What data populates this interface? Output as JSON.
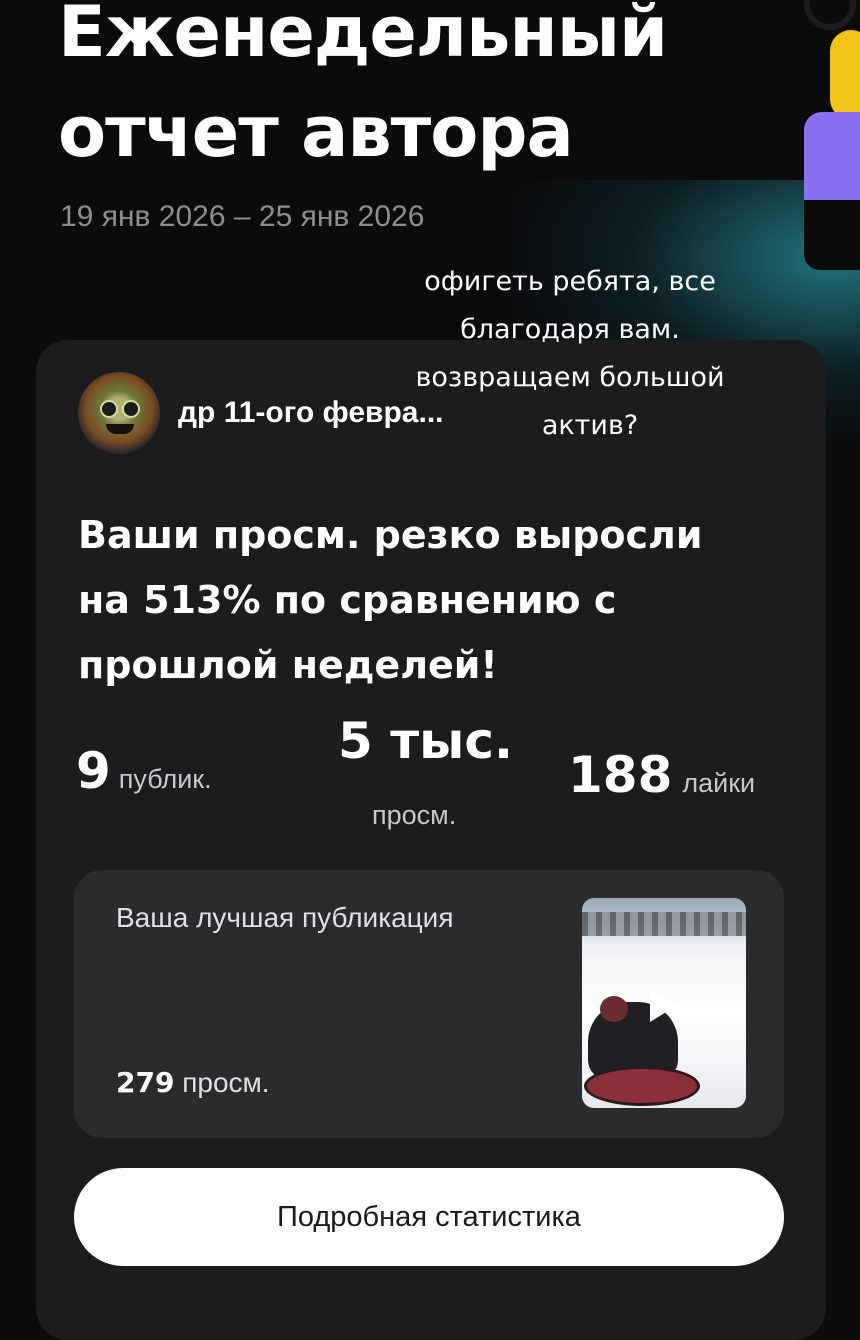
{
  "header": {
    "title_line1": "Еженедельный",
    "title_line2": "отчет автора",
    "date_range": "19 янв 2026 – 25 янв 2026"
  },
  "overlay_caption": {
    "line1": "офигеть ребята, все",
    "line2": "благодаря вам.",
    "line3": "возвращаем большой",
    "line4": "актив?"
  },
  "channel": {
    "name": "др 11-ого февра..."
  },
  "headline": {
    "line1": "Ваши просм. резко выросли",
    "line2": "на 513% по сравнению с",
    "line3": "прошлой неделей!"
  },
  "stats": {
    "publications_value": "9",
    "publications_label": "публик.",
    "views_value": "5 тыс.",
    "views_label": "просм.",
    "likes_value": "188",
    "likes_label": "лайки"
  },
  "best_post": {
    "label": "Ваша лучшая публикация",
    "views_value": "279",
    "views_label": "просм."
  },
  "actions": {
    "details_label": "Подробная статистика"
  },
  "colors": {
    "background": "#0b0b0c",
    "card": "#1c1c1e",
    "inner_card": "#2b2b2e",
    "accent_yellow": "#f2c418",
    "accent_purple": "#8a6ff0",
    "accent_teal": "#2896a0"
  },
  "icons": {
    "play": "play-icon"
  }
}
